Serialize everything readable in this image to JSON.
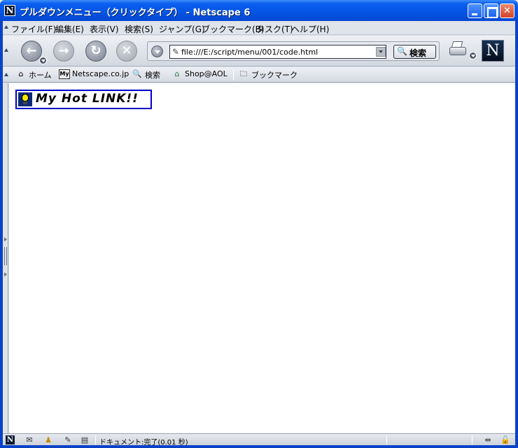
{
  "window": {
    "title": "プルダウンメニュー（クリックタイプ） - Netscape 6",
    "app_icon": "N",
    "minimize_icon": "minimize-icon",
    "maximize_icon": "maximize-icon",
    "close_label": "✕"
  },
  "menubar": {
    "items": [
      {
        "label": "ファイル(F)"
      },
      {
        "label": "編集(E)"
      },
      {
        "label": "表示(V)"
      },
      {
        "label": "検索(S)"
      },
      {
        "label": "ジャンプ(G)"
      },
      {
        "label": "ブックマーク(B)"
      },
      {
        "label": "タスク(T)"
      },
      {
        "label": "ヘルプ(H)"
      }
    ]
  },
  "navbar": {
    "back_glyph": "←",
    "forward_glyph": "→",
    "reload_glyph": "↻",
    "stop_glyph": "✕",
    "url": "file:///E:/script/menu/001/code.html",
    "search_label": "検索",
    "logo": "N"
  },
  "personal_toolbar": {
    "items": [
      {
        "label": "ホーム",
        "icon": "home-icon",
        "glyph": "⌂"
      },
      {
        "label": "Netscape.co.jp",
        "icon": "my-netscape-icon",
        "glyph": "My"
      },
      {
        "label": "検索",
        "icon": "search-icon",
        "glyph": "🔍"
      },
      {
        "label": "Shop@AOL",
        "icon": "shop-icon",
        "glyph": "⌂"
      }
    ],
    "bookmarks_label": "ブックマーク"
  },
  "content": {
    "hotlink_text": "My Hot LINK!!"
  },
  "statusbar": {
    "icons": [
      {
        "name": "navigator-icon",
        "glyph": "N"
      },
      {
        "name": "mail-icon",
        "glyph": "✉"
      },
      {
        "name": "instant-messenger-icon",
        "glyph": "♟"
      },
      {
        "name": "composer-icon",
        "glyph": "✎"
      },
      {
        "name": "address-book-icon",
        "glyph": "▤"
      }
    ],
    "status_text": "ドキュメント:完了(0.01 秒)",
    "right_icons": [
      {
        "name": "online-status-icon",
        "glyph": "⇹"
      },
      {
        "name": "security-lock-icon",
        "glyph": "🔓"
      }
    ]
  }
}
